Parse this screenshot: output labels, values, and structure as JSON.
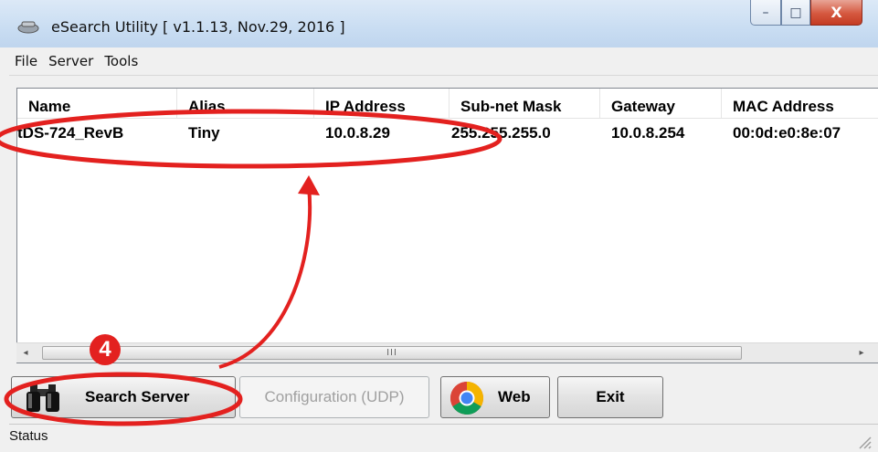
{
  "window": {
    "title": "eSearch Utility [ v1.1.13, Nov.29, 2016 ]",
    "icon": "esearch-app-icon",
    "controls": {
      "minimize": "–",
      "maximize": "□",
      "close": "X"
    }
  },
  "menu": [
    "File",
    "Server",
    "Tools"
  ],
  "table": {
    "columns": [
      "Name",
      "Alias",
      "IP Address",
      "Sub-net Mask",
      "Gateway",
      "MAC Address"
    ],
    "rows": [
      [
        "tDS-724_RevB",
        "Tiny",
        "10.0.8.29",
        "255.255.255.0",
        "10.0.8.254",
        "00:0d:e0:8e:07"
      ]
    ]
  },
  "scrollbar": {
    "left_arrow": "◂",
    "right_arrow": "▸",
    "grip": "III"
  },
  "buttons": {
    "search": "Search Server",
    "config": "Configuration (UDP)",
    "web": "Web",
    "exit": "Exit"
  },
  "status": {
    "text": "Status"
  },
  "annotation": {
    "step": "4",
    "color": "#e3211f"
  }
}
